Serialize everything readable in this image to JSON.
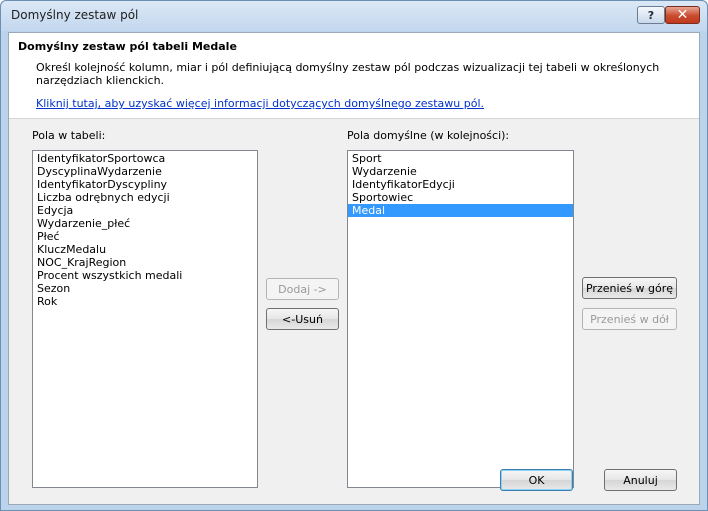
{
  "window": {
    "title": "Domyślny zestaw pól",
    "help_label": "?",
    "close_label": "✕"
  },
  "header": {
    "title": "Domyślny zestaw pól tabeli Medale",
    "description": "Określ kolejność kolumn, miar i pól definiującą domyślny zestaw pól podczas wizualizacji tej tabeli w określonych narzędziach klienckich.",
    "link": "Kliknij tutaj, aby uzyskać więcej informacji dotyczących domyślnego zestawu pól."
  },
  "table_fields": {
    "label": "Pola w tabeli:",
    "items": [
      "IdentyfikatorSportowca",
      "DyscyplinaWydarzenie",
      "IdentyfikatorDyscypliny",
      "Liczba odrębnych edycji",
      "Edycja",
      "Wydarzenie_płeć",
      "Płeć",
      "KluczMedalu",
      "NOC_KrajRegion",
      "Procent wszystkich medali",
      "Sezon",
      "Rok"
    ]
  },
  "default_fields": {
    "label": "Pola domyślne (w kolejności):",
    "items": [
      "Sport",
      "Wydarzenie",
      "IdentyfikatorEdycji",
      "Sportowiec",
      "Medal"
    ],
    "selected": "Medal"
  },
  "buttons": {
    "add": "Dodaj ->",
    "remove": "<-Usuń",
    "move_up": "Przenieś w górę",
    "move_down": "Przenieś w dół",
    "ok": "OK",
    "cancel": "Anuluj"
  }
}
